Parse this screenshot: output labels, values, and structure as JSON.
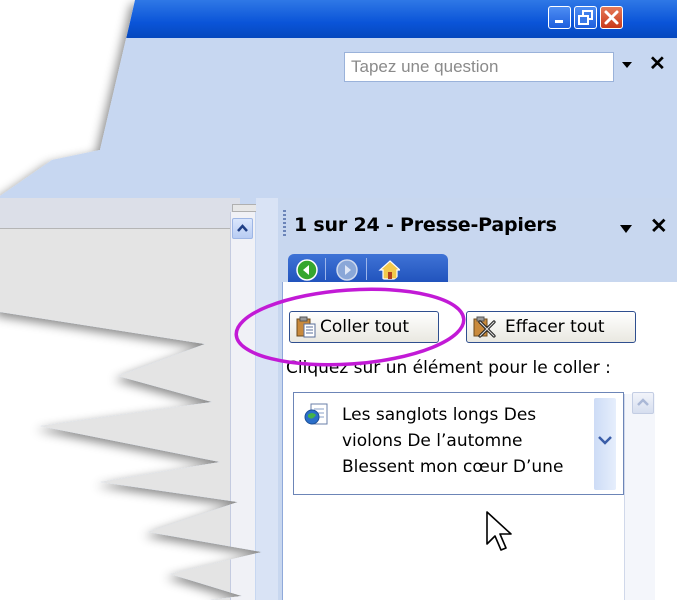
{
  "window": {
    "buttons": [
      "minimize",
      "maximize",
      "close"
    ],
    "question_box": {
      "placeholder": "Tapez une question"
    }
  },
  "task_pane": {
    "title": "1 sur 24 - Presse-Papiers",
    "nav_icons": [
      "back-icon",
      "forward-icon",
      "home-icon"
    ],
    "buttons": {
      "paste_all": "Coller tout",
      "clear_all": "Effacer tout"
    },
    "instruction": "Cliquez sur un élément pour le coller :",
    "items": [
      {
        "icon": "clipboard-item-icon",
        "lines": [
          "Les sanglots longs Des",
          "violons De l’automne",
          "Blessent mon cœur D’une"
        ]
      }
    ],
    "highlight_color": "#c21ad6"
  },
  "colors": {
    "titlebar": "#0a54d8",
    "pane_bg": "#c8d7ef",
    "accent_border": "#2f4f8f"
  }
}
